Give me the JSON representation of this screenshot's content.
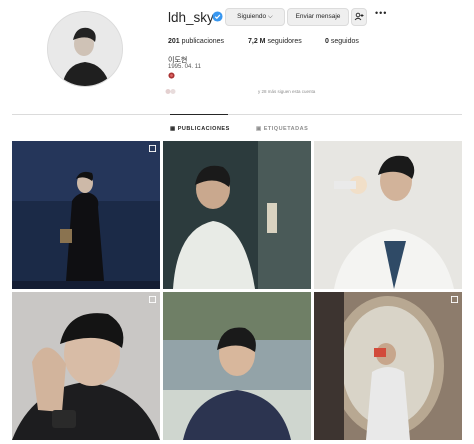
{
  "profile": {
    "username": "ldh_sky",
    "buttons": {
      "following": "Siguiendo ⌵",
      "message": "Enviar mensaje",
      "suggest_icon": "+ሾ"
    },
    "stats": {
      "posts_count": "201",
      "posts_label": "publicaciones",
      "followers_count": "7,2 M",
      "followers_label": "seguidores",
      "following_count": "0",
      "following_label": "seguidos"
    },
    "display_name": "이도현",
    "bio_line": "1995. 04. 11",
    "followed_by_note": "y 28 más siguen esta cuenta"
  },
  "tabs": {
    "posts": "PUBLICACIONES",
    "tagged": "ETIQUETADAS"
  },
  "colors": {
    "verified": "#3897f0",
    "text": "#262626",
    "muted": "#8e8e8e"
  }
}
